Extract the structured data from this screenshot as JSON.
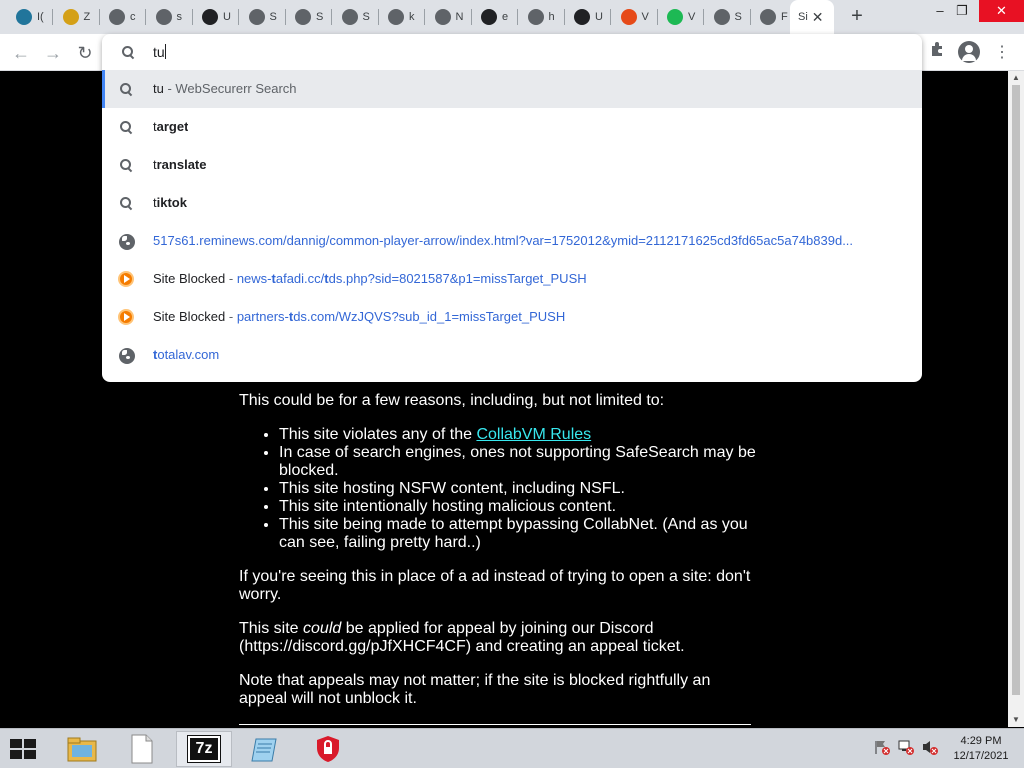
{
  "browser": {
    "tabs": [
      {
        "label": "I(",
        "icon": "wordpress-icon",
        "color": "#21759b"
      },
      {
        "label": "Z",
        "icon": "folder-image-icon",
        "color": "#d4a017"
      },
      {
        "label": "c",
        "icon": "globe-icon",
        "color": "#5f6368"
      },
      {
        "label": "s",
        "icon": "globe-icon",
        "color": "#5f6368"
      },
      {
        "label": "U",
        "icon": "eye-icon",
        "color": "#202124"
      },
      {
        "label": "S",
        "icon": "globe-icon",
        "color": "#5f6368"
      },
      {
        "label": "S",
        "icon": "globe-icon",
        "color": "#5f6368"
      },
      {
        "label": "S",
        "icon": "globe-icon",
        "color": "#5f6368"
      },
      {
        "label": "k",
        "icon": "globe-icon",
        "color": "#5f6368"
      },
      {
        "label": "N",
        "icon": "globe-icon",
        "color": "#5f6368"
      },
      {
        "label": "e",
        "icon": "shield-icon",
        "color": "#202124"
      },
      {
        "label": "h",
        "icon": "globe-icon",
        "color": "#5f6368"
      },
      {
        "label": "U",
        "icon": "eye-icon",
        "color": "#202124"
      },
      {
        "label": "V",
        "icon": "rainbow-icon",
        "color": "#e64a19"
      },
      {
        "label": "V",
        "icon": "shield-check-icon",
        "color": "#1db954"
      },
      {
        "label": "S",
        "icon": "globe-icon",
        "color": "#5f6368"
      },
      {
        "label": "F",
        "icon": "globe-icon",
        "color": "#5f6368"
      }
    ],
    "active_tab": {
      "label": "Si",
      "close": "✕"
    },
    "new_tab": "+",
    "window_controls": {
      "minimize": "–",
      "restore": "❐",
      "close": "✕"
    }
  },
  "toolbar": {
    "back": "←",
    "forward": "→",
    "reload": "↻",
    "menu": "⋮"
  },
  "omnibox": {
    "typed": "tu",
    "suggestions": [
      {
        "icon": "search-icon",
        "bold": "",
        "rest": "tu",
        "suffix": " - WebSecurerr Search"
      },
      {
        "icon": "search-icon",
        "lead": "t",
        "bold": "arget"
      },
      {
        "icon": "search-icon",
        "lead": "t",
        "bold": "ranslate"
      },
      {
        "icon": "search-icon",
        "lead": "t",
        "bold": "iktok"
      },
      {
        "icon": "globe-icon",
        "url": "517s61.reminews.com/dannig/common-player-arrow/index.html?var=1752012&ymid=2112171625cd3fd65ac5a74b839d..."
      },
      {
        "icon": "blocked-icon",
        "title": "Site Blocked",
        "sep": " - ",
        "url_pre": "news-",
        "url_b1": "t",
        "url_mid": "afadi.cc/",
        "url_b2": "t",
        "url_post": "ds.php?sid=8021587&p1=missTarget_PUSH"
      },
      {
        "icon": "blocked-icon",
        "title": "Site Blocked",
        "sep": " - ",
        "url_pre": "partners-",
        "url_b1": "t",
        "url_mid": "ds.com/WzJQVS?sub_id_1=missTarget_PUSH",
        "url_b2": "",
        "url_post": ""
      },
      {
        "icon": "globe-icon",
        "url_b1": "t",
        "url_post": "otalav.com"
      }
    ]
  },
  "page": {
    "intro": "This could be for a few reasons, including, but not limited to:",
    "reasons": {
      "r1_pre": "This site violates any of the ",
      "r1_link": "CollabVM Rules",
      "r2": "In case of search engines, ones not supporting SafeSearch may be blocked.",
      "r3": "This site hosting NSFW content, including NSFL.",
      "r4": "This site intentionally hosting malicious content.",
      "r5": "This site being made to attempt bypassing CollabNet. (And as you can see, failing pretty hard..)"
    },
    "ad_note": "If you're seeing this in place of a ad instead of trying to open a site: don't worry.",
    "appeal_pre": "This site ",
    "appeal_em": "could",
    "appeal_post": " be applied for appeal by joining our Discord (https://discord.gg/pJfXHCF4CF) and creating an appeal ticket.",
    "appeal_note": "Note that appeals may not matter; if the site is blocked rightfully an appeal will not unblock it."
  },
  "taskbar": {
    "apps": [
      {
        "name": "file-explorer-icon"
      },
      {
        "name": "notepad-icon"
      },
      {
        "name": "7zip-icon",
        "label": "7z"
      },
      {
        "name": "notepad-blue-icon"
      },
      {
        "name": "security-shield-icon"
      }
    ],
    "clock_time": "4:29 PM",
    "clock_date": "12/17/2021"
  }
}
